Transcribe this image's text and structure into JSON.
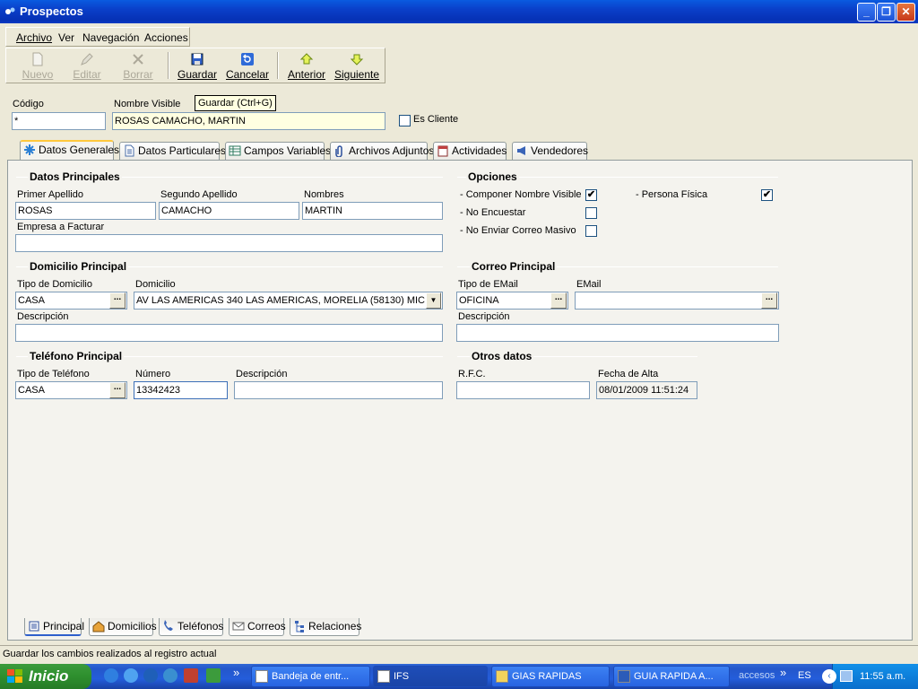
{
  "window": {
    "title": "Prospectos",
    "minimize": "_",
    "maximize": "❐",
    "close": "✕"
  },
  "menu": [
    "Archivo",
    "Ver",
    "Navegación",
    "Acciones"
  ],
  "toolbar": {
    "nuevo": "Nuevo",
    "editar": "Editar",
    "borrar": "Borrar",
    "guardar": "Guardar",
    "cancelar": "Cancelar",
    "anterior": "Anterior",
    "siguiente": "Siguiente"
  },
  "tooltip": "Guardar (Ctrl+G)",
  "header": {
    "codigo_label": "Código",
    "codigo_value": "*",
    "nombre_visible_label": "Nombre Visible",
    "nombre_visible_value": "ROSAS CAMACHO, MARTIN",
    "es_cliente_label": "Es Cliente"
  },
  "tabs": [
    "Datos Generales",
    "Datos Particulares",
    "Campos Variables",
    "Archivos Adjuntos",
    "Actividades",
    "Vendedores"
  ],
  "datos_principales": {
    "title": "Datos Principales",
    "primer_apellido_label": "Primer Apellido",
    "primer_apellido": "ROSAS",
    "segundo_apellido_label": "Segundo Apellido",
    "segundo_apellido": "CAMACHO",
    "nombres_label": "Nombres",
    "nombres": "MARTIN",
    "empresa_label": "Empresa a Facturar",
    "empresa": ""
  },
  "opciones": {
    "title": "Opciones",
    "componer_label": "- Componer Nombre Visible",
    "componer_checked": "✔",
    "no_encuestar_label": "- No Encuestar",
    "no_correo_label": "- No Enviar Correo Masivo",
    "persona_fisica_label": "- Persona Física",
    "persona_fisica_checked": "✔"
  },
  "domicilio": {
    "title": "Domicilio Principal",
    "tipo_label": "Tipo de Domicilio",
    "tipo": "CASA",
    "domicilio_label": "Domicilio",
    "domicilio": "AV LAS AMERICAS  340 LAS AMERICAS, MORELIA (58130) MIC",
    "descripcion_label": "Descripción",
    "descripcion": ""
  },
  "correo": {
    "title": "Correo Principal",
    "tipo_label": "Tipo de EMail",
    "tipo": "OFICINA",
    "email_label": "EMail",
    "email": "",
    "descripcion_label": "Descripción",
    "descripcion": ""
  },
  "telefono": {
    "title": "Teléfono Principal",
    "tipo_label": "Tipo de Teléfono",
    "tipo": "CASA",
    "numero_label": "Número",
    "numero": "13342423",
    "descripcion_label": "Descripción",
    "descripcion": ""
  },
  "otros": {
    "title": "Otros datos",
    "rfc_label": "R.F.C.",
    "rfc": "",
    "fecha_label": "Fecha de Alta",
    "fecha": "08/01/2009 11:51:24"
  },
  "bottom_tabs": [
    "Principal",
    "Domicilios",
    "Teléfonos",
    "Correos",
    "Relaciones"
  ],
  "status": "Guardar los cambios realizados al registro actual",
  "taskbar": {
    "start": "Inicio",
    "chevron": "»",
    "items": [
      "Bandeja de entr...",
      "IFS",
      "GIAS RAPIDAS",
      "GUIA RAPIDA A..."
    ],
    "accesos": "accesos",
    "lang": "ES",
    "clock": "11:55 a.m."
  },
  "ellipsis": "...",
  "dropdown_arrow": "▼"
}
